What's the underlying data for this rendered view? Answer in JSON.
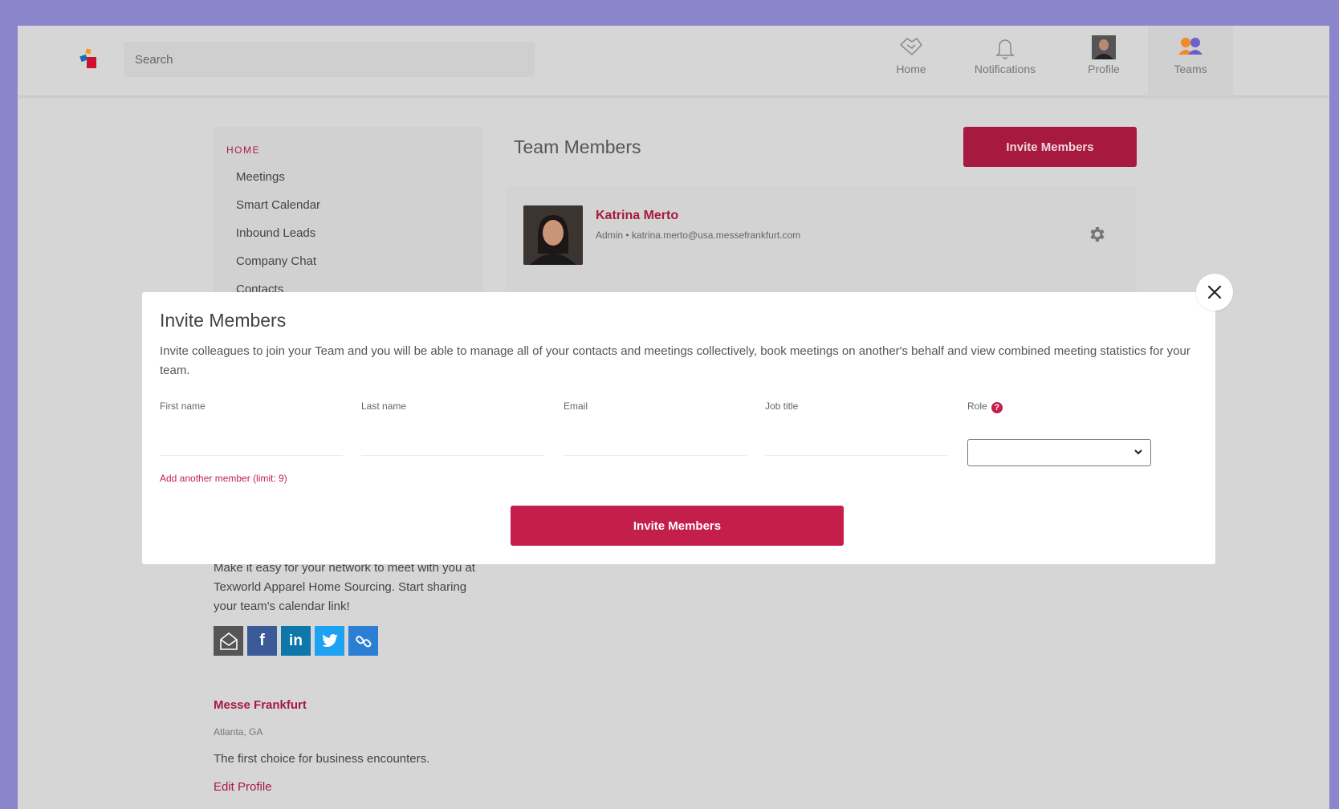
{
  "search": {
    "placeholder": "Search"
  },
  "nav": {
    "home": "Home",
    "notifications": "Notifications",
    "profile": "Profile",
    "teams": "Teams"
  },
  "sidebar": {
    "heading": "HOME",
    "items": [
      "Meetings",
      "Smart Calendar",
      "Inbound Leads",
      "Company Chat",
      "Contacts"
    ]
  },
  "main": {
    "title": "Team Members",
    "invite_button": "Invite Members",
    "member": {
      "name": "Katrina Merto",
      "role": "Admin",
      "email": "katrina.merto@usa.messefrankfurt.com"
    }
  },
  "share": {
    "text": "Make it easy for your network to meet with you at Texworld Apparel Home Sourcing. Start sharing your team's calendar link!"
  },
  "company": {
    "name": "Messe Frankfurt",
    "location": "Atlanta, GA",
    "tagline": "The first choice for business encounters.",
    "edit_link": "Edit Profile"
  },
  "modal": {
    "title": "Invite Members",
    "description": "Invite colleagues to join your Team and you will be able to manage all of your contacts and meetings collectively, book meetings on another's behalf and view combined meeting statistics for your team.",
    "labels": {
      "first_name": "First name",
      "last_name": "Last name",
      "email": "Email",
      "job_title": "Job title",
      "role": "Role"
    },
    "add_another": "Add another member (limit: 9)",
    "submit": "Invite Members"
  },
  "colors": {
    "accent": "#c41e4a",
    "background": "#8b86cc"
  }
}
